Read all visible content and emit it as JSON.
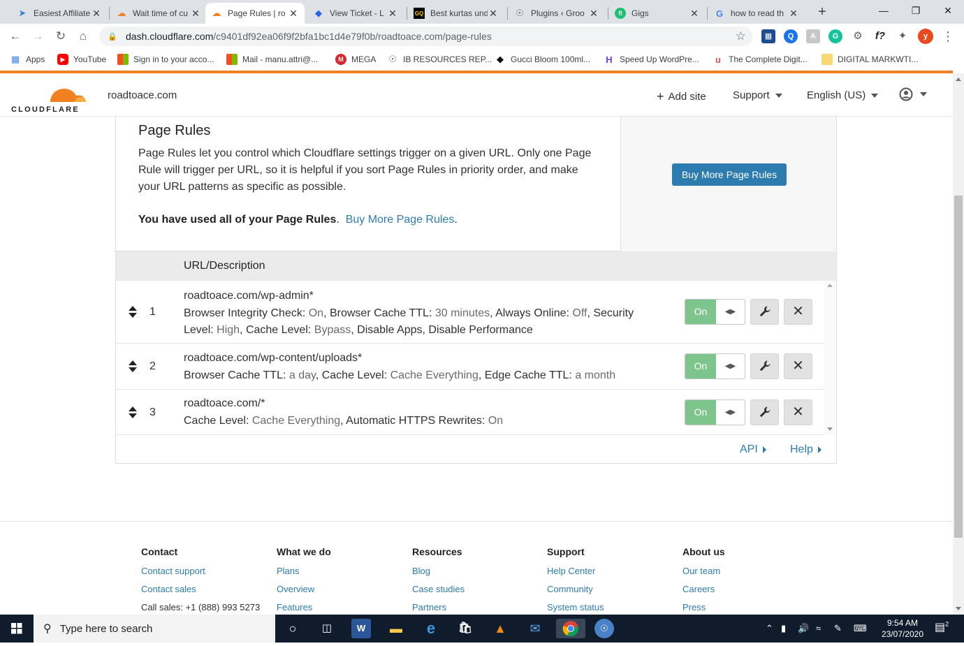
{
  "browser": {
    "tabs": [
      {
        "title": "Easiest Affiliate",
        "favicon": "affiliate-icon",
        "active": false
      },
      {
        "title": "Wait time of cu",
        "favicon": "cloudflare-icon",
        "active": false
      },
      {
        "title": "Page Rules | ro",
        "favicon": "cloudflare-icon",
        "active": true
      },
      {
        "title": "View Ticket - L",
        "favicon": "ticket-icon",
        "active": false
      },
      {
        "title": "Best kurtas und",
        "favicon": "gq-icon",
        "active": false
      },
      {
        "title": "Plugins ‹ Groo",
        "favicon": "globe-icon",
        "active": false
      },
      {
        "title": "Gigs",
        "favicon": "fiverr-icon",
        "active": false
      },
      {
        "title": "how to read th",
        "favicon": "google-icon",
        "active": false
      }
    ],
    "new_tab": "+",
    "url_host": "dash.cloudflare.com",
    "url_path": "/c9401df92ea06f9f2bfa1bc1d4e79f0b/roadtoace.com/page-rules",
    "profile_initial": "y",
    "bookmarks": [
      {
        "label": "Apps",
        "icon": "apps-grid-icon"
      },
      {
        "label": "YouTube",
        "icon": "youtube-icon"
      },
      {
        "label": "Sign in to your acco...",
        "icon": "microsoft-icon"
      },
      {
        "label": "Mail - manu.attri@...",
        "icon": "microsoft-icon"
      },
      {
        "label": "MEGA",
        "icon": "mega-icon"
      },
      {
        "label": "IB RESOURCES REP...",
        "icon": "globe-icon"
      },
      {
        "label": "Gucci Bloom 100ml...",
        "icon": "diamond-icon"
      },
      {
        "label": "Speed Up WordPre...",
        "icon": "hostinger-icon"
      },
      {
        "label": "The Complete Digit...",
        "icon": "udemy-icon"
      },
      {
        "label": "DIGITAL MARKWTI...",
        "icon": "folder-icon"
      }
    ]
  },
  "cf_header": {
    "logo_text": "CLOUDFLARE",
    "site": "roadtoace.com",
    "add_site": "Add site",
    "support": "Support",
    "language": "English (US)"
  },
  "page_rules": {
    "title": "Page Rules",
    "description": "Page Rules let you control which Cloudflare settings trigger on a given URL. Only one Page Rule will trigger per URL, so it is helpful if you sort Page Rules in priority order, and make your URL patterns as specific as possible.",
    "used_text": "You have used all of your Page Rules",
    "used_link": "Buy More Page Rules",
    "buy_button": "Buy More Page Rules",
    "column_header": "URL/Description",
    "rules": [
      {
        "number": "1",
        "url": "roadtoace.com/wp-admin*",
        "settings": [
          {
            "k": "Browser Integrity Check",
            "v": "On"
          },
          {
            "k": "Browser Cache TTL",
            "v": "30 minutes"
          },
          {
            "k": "Always Online",
            "v": "Off"
          },
          {
            "k": "Security Level",
            "v": "High"
          },
          {
            "k": "Cache Level",
            "v": "Bypass"
          },
          {
            "k": "Disable Apps",
            "v": ""
          },
          {
            "k": "Disable Performance",
            "v": ""
          }
        ],
        "toggle": "On"
      },
      {
        "number": "2",
        "url": "roadtoace.com/wp-content/uploads*",
        "settings": [
          {
            "k": "Browser Cache TTL",
            "v": "a day"
          },
          {
            "k": "Cache Level",
            "v": "Cache Everything"
          },
          {
            "k": "Edge Cache TTL",
            "v": "a month"
          }
        ],
        "toggle": "On"
      },
      {
        "number": "3",
        "url": "roadtoace.com/*",
        "settings": [
          {
            "k": "Cache Level",
            "v": "Cache Everything"
          },
          {
            "k": "Automatic HTTPS Rewrites",
            "v": "On"
          }
        ],
        "toggle": "On"
      }
    ],
    "api_link": "API",
    "help_link": "Help"
  },
  "footer": {
    "columns": [
      {
        "heading": "Contact",
        "links": [
          "Contact support",
          "Contact sales"
        ],
        "text": "Call sales: +1 (888) 993 5273"
      },
      {
        "heading": "What we do",
        "links": [
          "Plans",
          "Overview",
          "Features"
        ]
      },
      {
        "heading": "Resources",
        "links": [
          "Blog",
          "Case studies",
          "Partners"
        ]
      },
      {
        "heading": "Support",
        "links": [
          "Help Center",
          "Community",
          "System status"
        ]
      },
      {
        "heading": "About us",
        "links": [
          "Our team",
          "Careers",
          "Press"
        ]
      }
    ]
  },
  "taskbar": {
    "search_placeholder": "Type here to search",
    "time": "9:54 AM",
    "date": "23/07/2020",
    "notifications": "2"
  },
  "colors": {
    "cf_orange": "#f38020",
    "link_blue": "#2c7cb0",
    "toggle_green": "#7dc58c"
  }
}
